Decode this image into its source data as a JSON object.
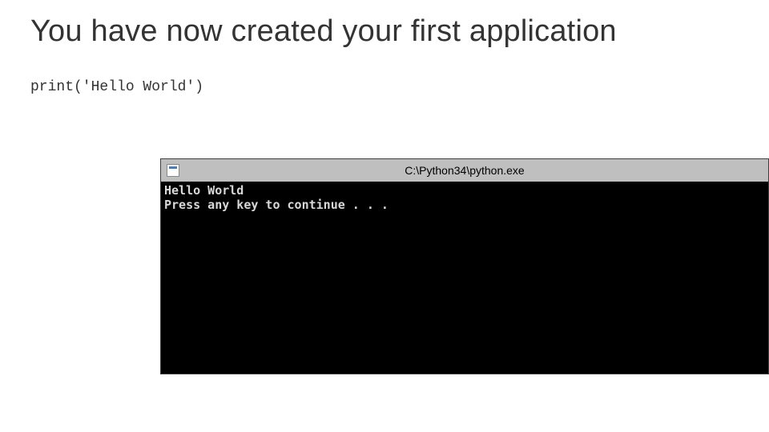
{
  "slide": {
    "title": "You have now created your first application",
    "code": "print('Hello World')"
  },
  "console": {
    "title": "C:\\Python34\\python.exe",
    "output_line1": "Hello World",
    "output_line2": "Press any key to continue . . ."
  }
}
